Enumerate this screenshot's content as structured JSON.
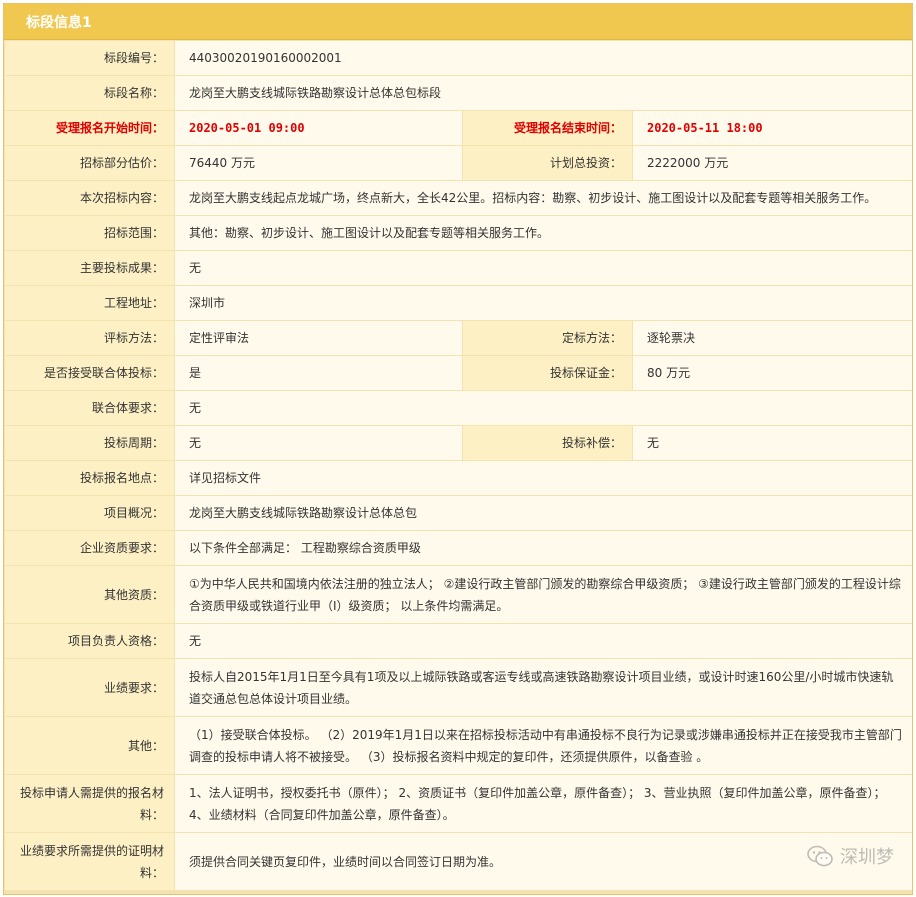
{
  "header": {
    "title": "标段信息1"
  },
  "rows": {
    "r1": {
      "label": "标段编号：",
      "value": "44030020190160002001"
    },
    "r2": {
      "label": "标段名称：",
      "value": "龙岗至大鹏支线城际铁路勘察设计总体总包标段"
    },
    "r3": {
      "label1": "受理报名开始时间：",
      "value1": "2020-05-01 09:00",
      "label2": "受理报名结束时间：",
      "value2": "2020-05-11 18:00"
    },
    "r4": {
      "label1": "招标部分估价：",
      "value1": "76440 万元",
      "label2": "计划总投资：",
      "value2": "2222000 万元"
    },
    "r5": {
      "label": "本次招标内容：",
      "value": "龙岗至大鹏支线起点龙城广场，终点新大，全长42公里。招标内容：勘察、初步设计、施工图设计以及配套专题等相关服务工作。"
    },
    "r6": {
      "label": "招标范围：",
      "value": "其他：勘察、初步设计、施工图设计以及配套专题等相关服务工作。"
    },
    "r7": {
      "label": "主要投标成果：",
      "value": "无"
    },
    "r8": {
      "label": "工程地址：",
      "value": "深圳市"
    },
    "r9": {
      "label1": "评标方法：",
      "value1": "定性评审法",
      "label2": "定标方法：",
      "value2": "逐轮票决"
    },
    "r10": {
      "label1": "是否接受联合体投标：",
      "value1": "是",
      "label2": "投标保证金：",
      "value2": "80 万元"
    },
    "r11": {
      "label": "联合体要求：",
      "value": "无"
    },
    "r12": {
      "label1": "投标周期：",
      "value1": "无",
      "label2": "投标补偿：",
      "value2": "无"
    },
    "r13": {
      "label": "投标报名地点：",
      "value": "详见招标文件"
    },
    "r14": {
      "label": "项目概况：",
      "value": "龙岗至大鹏支线城际铁路勘察设计总体总包"
    },
    "r15": {
      "label": "企业资质要求：",
      "value": "以下条件全部满足： 工程勘察综合资质甲级"
    },
    "r16": {
      "label": "其他资质：",
      "value": "①为中华人民共和国境内依法注册的独立法人；  ②建设行政主管部门颁发的勘察综合甲级资质；  ③建设行政主管部门颁发的工程设计综合资质甲级或铁道行业甲（I）级资质；  以上条件均需满足。"
    },
    "r17": {
      "label": "项目负责人资格：",
      "value": "无"
    },
    "r18": {
      "label": "业绩要求：",
      "value": "投标人自2015年1月1日至今具有1项及以上城际铁路或客运专线或高速铁路勘察设计项目业绩，或设计时速160公里/小时城市快速轨道交通总包总体设计项目业绩。"
    },
    "r19": {
      "label": "其他：",
      "value": "（1）接受联合体投标。 （2）2019年1月1日以来在招标投标活动中有串通投标不良行为记录或涉嫌串通投标并正在接受我市主管部门调查的投标申请人将不被接受。 （3）投标报名资料中规定的复印件，还须提供原件，以备查验 。"
    },
    "r20": {
      "label": "投标申请人需提供的报名材料：",
      "value": "1、法人证明书，授权委托书（原件）； 2、资质证书（复印件加盖公章，原件备查）； 3、营业执照（复印件加盖公章，原件备查）； 4、业绩材料（合同复印件加盖公章，原件备查）。"
    },
    "r21": {
      "label": "业绩要求所需提供的证明材料：",
      "value": "须提供合同关键页复印件，业绩时间以合同签订日期为准。"
    }
  },
  "watermark": {
    "text": "深圳梦",
    "icon": "wechat-icon"
  },
  "colors": {
    "header_bg": "#f0c850",
    "label_bg": "#fdf0c4",
    "value_bg": "#fffaeb",
    "highlight_text": "#e00000"
  }
}
